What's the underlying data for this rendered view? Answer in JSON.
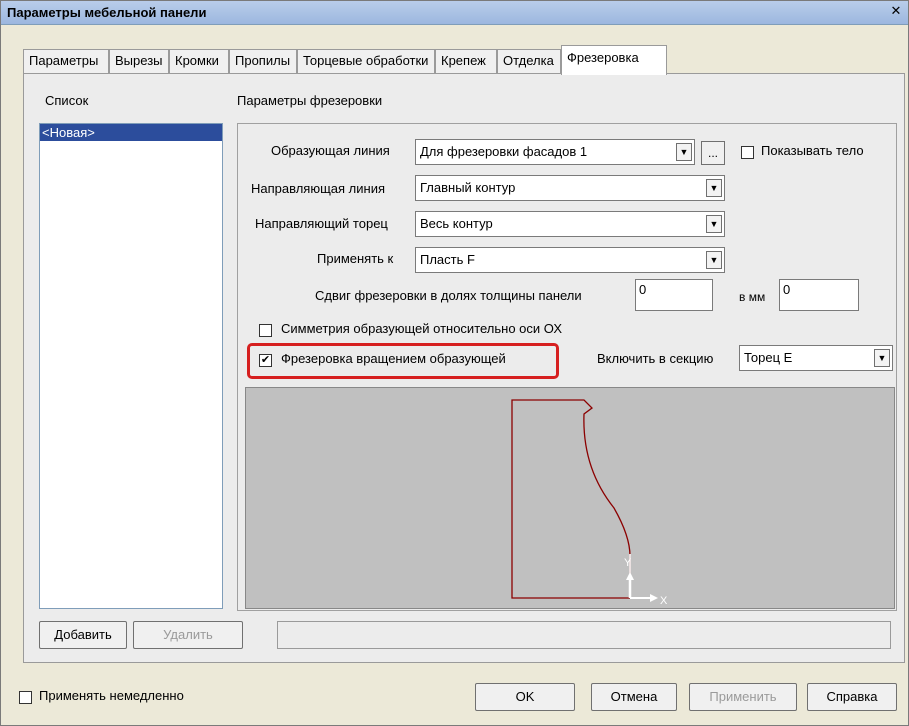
{
  "window": {
    "title": "Параметры мебельной панели",
    "close_symbol": "✕"
  },
  "tabs": [
    {
      "label": "Параметры"
    },
    {
      "label": "Вырезы"
    },
    {
      "label": "Кромки"
    },
    {
      "label": "Пропилы"
    },
    {
      "label": "Торцевые обработки"
    },
    {
      "label": "Крепеж"
    },
    {
      "label": "Отделка"
    },
    {
      "label": "Фрезеровка",
      "active": true
    }
  ],
  "list": {
    "heading": "Список",
    "items": [
      "<Новая>"
    ],
    "add_label": "Добавить",
    "delete_label": "Удалить"
  },
  "milling": {
    "heading": "Параметры фрезеровки",
    "forming_line_label": "Образующая линия",
    "forming_line_value": "Для фрезеровки фасадов 1",
    "more_button": "...",
    "show_body_label": "Показывать тело",
    "show_body_checked": false,
    "guide_line_label": "Направляющая линия",
    "guide_line_value": "Главный контур",
    "guide_end_label": "Направляющий торец",
    "guide_end_value": "Весь контур",
    "apply_to_label": "Применять к",
    "apply_to_value": "Пласть F",
    "shift_label": "Сдвиг фрезеровки в долях толщины панели",
    "shift_value": "0",
    "mm_label": "в мм",
    "mm_value": "0",
    "symmetry_label": "Симметрия образующей относительно оси ОХ",
    "symmetry_checked": false,
    "rotation_label": "Фрезеровка вращением образующей",
    "rotation_checked": true,
    "section_label": "Включить в секцию",
    "section_value": "Торец E",
    "axis_y": "Y",
    "axis_x": "X"
  },
  "footer": {
    "apply_immediately_label": "Применять немедленно",
    "apply_immediately_checked": false,
    "ok_label": "OK",
    "cancel_label": "Отмена",
    "apply_label": "Применить",
    "help_label": "Справка"
  },
  "colors": {
    "highlight": "#d61f1f",
    "profile_line": "#8b0000",
    "selection": "#2c4d9c"
  },
  "icons": {
    "dropdown": "▼",
    "check": "✔"
  }
}
